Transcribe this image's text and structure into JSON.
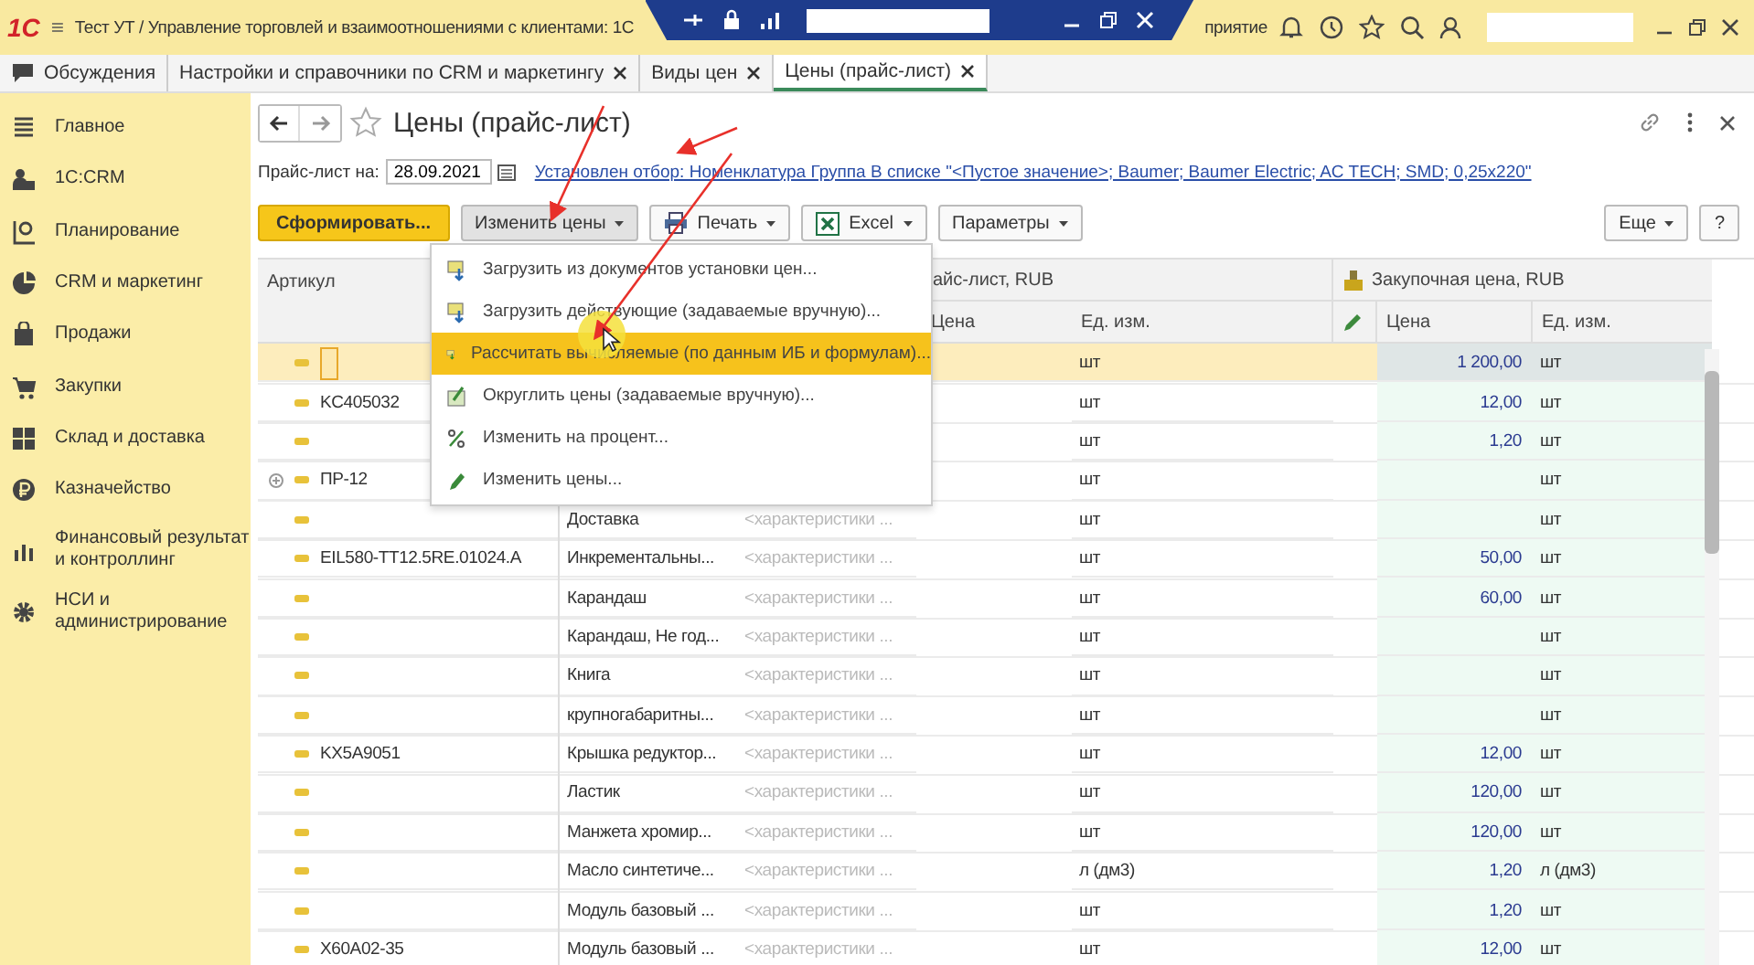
{
  "app_bar": {
    "logo": "1С",
    "title": "Тест УТ / Управление торговлей и взаимоотношениями с клиентами: 1С",
    "title_end": "приятие"
  },
  "open_tabs": [
    {
      "label": "Обсуждения",
      "selected": false,
      "closable": false
    },
    {
      "label": "Настройки и справочники по CRM и маркетингу",
      "selected": false,
      "closable": true
    },
    {
      "label": "Виды цен",
      "selected": false,
      "closable": true
    },
    {
      "label": "Цены (прайс-лист)",
      "selected": true,
      "closable": true
    }
  ],
  "sidebar": {
    "items": [
      {
        "label": "Главное"
      },
      {
        "label": "1С:CRM"
      },
      {
        "label": "Планирование"
      },
      {
        "label": "CRM и маркетинг"
      },
      {
        "label": "Продажи"
      },
      {
        "label": "Закупки"
      },
      {
        "label": "Склад и доставка"
      },
      {
        "label": "Казначейство"
      },
      {
        "label": "Финансовый результат и контроллинг"
      },
      {
        "label": "НСИ и администрирование"
      }
    ]
  },
  "form": {
    "title": "Цены (прайс-лист)",
    "date_label": "Прайс-лист на:",
    "date_value": "28.09.2021",
    "filter_link": "Установлен отбор: Номенклатура Группа В списке \"<Пустое значение>; Baumer; Baumer Electric; AC TECH; SMD; 0,25x220\""
  },
  "toolbar": {
    "buttons": [
      {
        "label": "Сформировать...",
        "kind": "primary",
        "expanded": false
      },
      {
        "label": "Изменить цены",
        "kind": "menu",
        "expanded": true
      },
      {
        "label": "Печать",
        "kind": "menu",
        "expanded": false
      },
      {
        "label": "Excel",
        "kind": "menu",
        "expanded": false
      },
      {
        "label": "Параметры",
        "kind": "menu",
        "expanded": false
      }
    ],
    "right_buttons": [
      {
        "label": "Еще",
        "kind": "menu",
        "expanded": false
      },
      {
        "label": "?",
        "kind": "plain",
        "expanded": false
      }
    ]
  },
  "menu": {
    "items": [
      {
        "label": "Загрузить из документов установки цен...",
        "selected": false
      },
      {
        "label": "Загрузить действующие (задаваемые вручную)...",
        "selected": false
      },
      {
        "label": "Рассчитать вычисляемые (по данным ИБ и формулам)...",
        "selected": true
      },
      {
        "label": "Округлить цены (задаваемые вручную)...",
        "selected": false
      },
      {
        "label": "Изменить на процент...",
        "selected": false
      },
      {
        "label": "Изменить цены...",
        "selected": false
      }
    ]
  },
  "table": {
    "article_header": "Артикул",
    "price_list_group": "айс-лист, RUB",
    "purchase_group": "Закупочная цена, RUB",
    "price_list_price": "Цена",
    "price_list_unit": "Ед. изм.",
    "purchase_price": "Цена",
    "purchase_unit": "Ед. изм.",
    "rows": [
      {
        "article": "",
        "expandable": false,
        "editing": true,
        "selected": true,
        "unit": "шт",
        "purchase_price": "1 200,00",
        "purchase_unit": "шт"
      },
      {
        "article": "KC405032",
        "expandable": false,
        "editing": false,
        "selected": false,
        "unit": "шт",
        "purchase_price": "12,00",
        "purchase_unit": "шт"
      },
      {
        "article": "",
        "expandable": false,
        "editing": false,
        "selected": false,
        "unit": "шт",
        "purchase_price": "1,20",
        "purchase_unit": "шт"
      },
      {
        "article": "ПР-12",
        "expandable": true,
        "editing": false,
        "selected": false,
        "unit": "шт",
        "purchase_price": "",
        "purchase_unit": "шт"
      },
      {
        "article": "",
        "expandable": false,
        "editing": false,
        "selected": false,
        "name": "Доставка",
        "characteristic": "<характеристики ...",
        "unit": "шт",
        "purchase_price": "",
        "purchase_unit": "шт"
      },
      {
        "article": "EIL580-TT12.5RE.01024.A",
        "expandable": false,
        "editing": false,
        "selected": false,
        "name": "Инкрементальны...",
        "characteristic": "<характеристики ...",
        "unit": "шт",
        "purchase_price": "50,00",
        "purchase_unit": "шт"
      },
      {
        "article": "",
        "expandable": false,
        "editing": false,
        "selected": false,
        "name": "Карандаш",
        "characteristic": "<характеристики ...",
        "unit": "шт",
        "purchase_price": "60,00",
        "purchase_unit": "шт"
      },
      {
        "article": "",
        "expandable": false,
        "editing": false,
        "selected": false,
        "name": "Карандаш, Не год...",
        "characteristic": "<характеристики ...",
        "unit": "шт",
        "purchase_price": "",
        "purchase_unit": "шт"
      },
      {
        "article": "",
        "expandable": false,
        "editing": false,
        "selected": false,
        "name": "Книга",
        "characteristic": "<характеристики ...",
        "unit": "шт",
        "purchase_price": "",
        "purchase_unit": "шт"
      },
      {
        "article": "",
        "expandable": false,
        "editing": false,
        "selected": false,
        "name": "крупногабаритны...",
        "characteristic": "<характеристики ...",
        "unit": "шт",
        "purchase_price": "",
        "purchase_unit": "шт"
      },
      {
        "article": "KX5A9051",
        "expandable": false,
        "editing": false,
        "selected": false,
        "name": "Крышка редуктор...",
        "characteristic": "<характеристики ...",
        "unit": "шт",
        "purchase_price": "12,00",
        "purchase_unit": "шт"
      },
      {
        "article": "",
        "expandable": false,
        "editing": false,
        "selected": false,
        "name": "Ластик",
        "characteristic": "<характеристики ...",
        "unit": "шт",
        "purchase_price": "120,00",
        "purchase_unit": "шт"
      },
      {
        "article": "",
        "expandable": false,
        "editing": false,
        "selected": false,
        "name": "Манжета хромир...",
        "characteristic": "<характеристики ...",
        "unit": "шт",
        "purchase_price": "120,00",
        "purchase_unit": "шт"
      },
      {
        "article": "",
        "expandable": false,
        "editing": false,
        "selected": false,
        "name": "Масло синтетиче...",
        "characteristic": "<характеристики ...",
        "unit": "л (дм3)",
        "purchase_price": "1,20",
        "purchase_unit": "л (дм3)"
      },
      {
        "article": "",
        "expandable": false,
        "editing": false,
        "selected": false,
        "name": "Модуль базовый ...",
        "characteristic": "<характеристики ...",
        "unit": "шт",
        "purchase_price": "1,20",
        "purchase_unit": "шт"
      },
      {
        "article": "X60A02-35",
        "expandable": false,
        "editing": false,
        "selected": false,
        "name": "Модуль базовый ...",
        "characteristic": "<характеристики ...",
        "unit": "шт",
        "purchase_price": "12,00",
        "purchase_unit": "шт"
      }
    ]
  }
}
